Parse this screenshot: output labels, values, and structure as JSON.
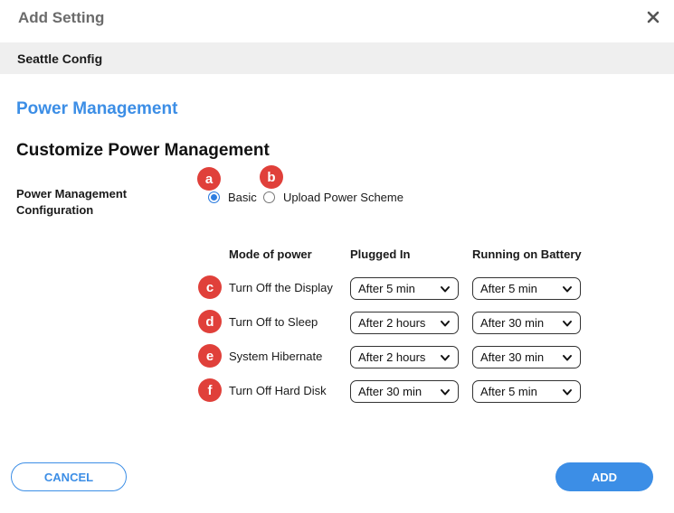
{
  "dialog": {
    "title": "Add Setting",
    "close_icon": "close-x-icon"
  },
  "config": {
    "name": "Seattle Config"
  },
  "section": {
    "title": "Power Management",
    "subtitle": "Customize Power Management",
    "config_label": "Power Management Configuration"
  },
  "badges": [
    "a",
    "b",
    "c",
    "d",
    "e",
    "f"
  ],
  "radio": {
    "options": [
      "Basic",
      "Upload Power Scheme"
    ],
    "selected": "Basic"
  },
  "table": {
    "headers": [
      "Mode of power",
      "Plugged In",
      "Running on Battery"
    ],
    "rows": [
      {
        "label": "Turn Off the Display",
        "plugged": "After 5 min",
        "battery": "After 5 min"
      },
      {
        "label": "Turn Off to Sleep",
        "plugged": "After 2 hours",
        "battery": "After 30 min"
      },
      {
        "label": "System Hibernate",
        "plugged": "After 2 hours",
        "battery": "After 30 min"
      },
      {
        "label": "Turn Off Hard Disk",
        "plugged": "After 30 min",
        "battery": "After 5 min"
      }
    ]
  },
  "buttons": {
    "cancel": "CANCEL",
    "add": "ADD"
  },
  "colors": {
    "accent": "#3c8ee6",
    "badge": "#e0403a",
    "bar": "#efefef"
  }
}
